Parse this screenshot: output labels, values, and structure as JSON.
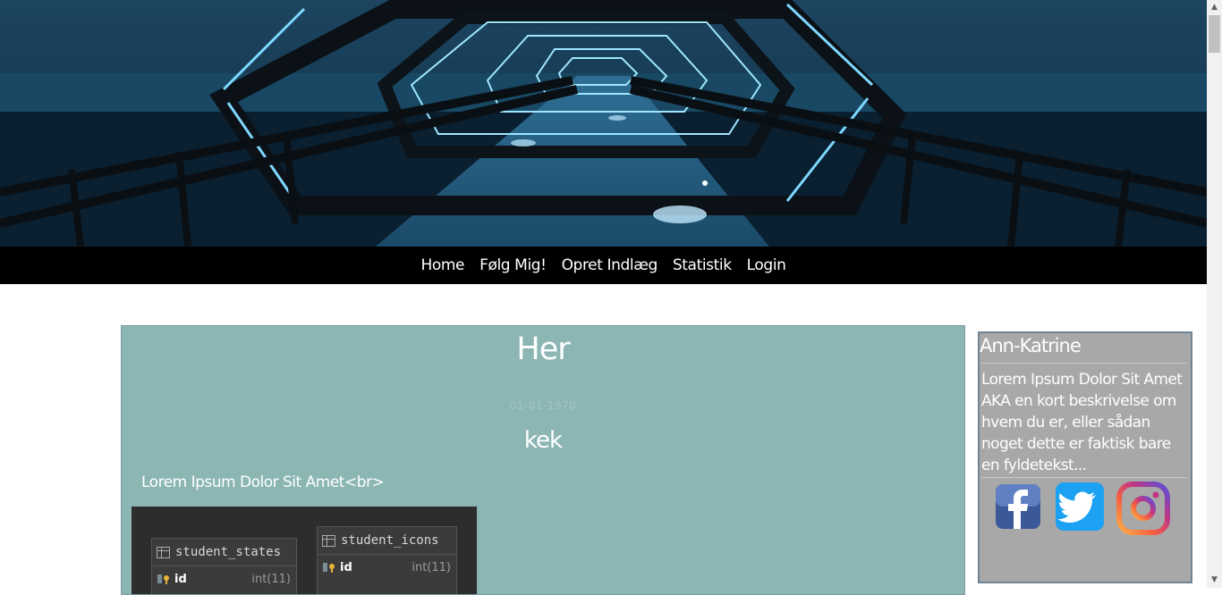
{
  "nav": {
    "items": [
      {
        "label": "Home"
      },
      {
        "label": "Følg Mig!"
      },
      {
        "label": "Opret Indlæg"
      },
      {
        "label": "Statistik"
      },
      {
        "label": "Login"
      }
    ]
  },
  "post": {
    "title": "Her",
    "date": "01-01-1970",
    "subtitle": "kek",
    "body": "Lorem Ipsum Dolor Sit Amet<br>",
    "image": {
      "tables": [
        {
          "name": "student_states",
          "columns": [
            {
              "name": "id",
              "type": "int(11)"
            }
          ]
        },
        {
          "name": "student_icons",
          "columns": [
            {
              "name": "id",
              "type": "int(11)"
            }
          ]
        }
      ]
    }
  },
  "sidebar": {
    "name": "Ann-Katrine",
    "description": "Lorem Ipsum Dolor Sit Amet AKA en kort beskrivelse om hvem du er, eller sådan noget dette er faktisk bare en fyldetekst...",
    "social": [
      {
        "icon": "facebook-icon"
      },
      {
        "icon": "twitter-icon"
      },
      {
        "icon": "instagram-icon"
      }
    ]
  },
  "colors": {
    "nav_bg": "#000000",
    "post_bg": "#8bb6b4",
    "sidebar_bg": "#a8a8a8",
    "sidebar_border": "#6f8596"
  }
}
